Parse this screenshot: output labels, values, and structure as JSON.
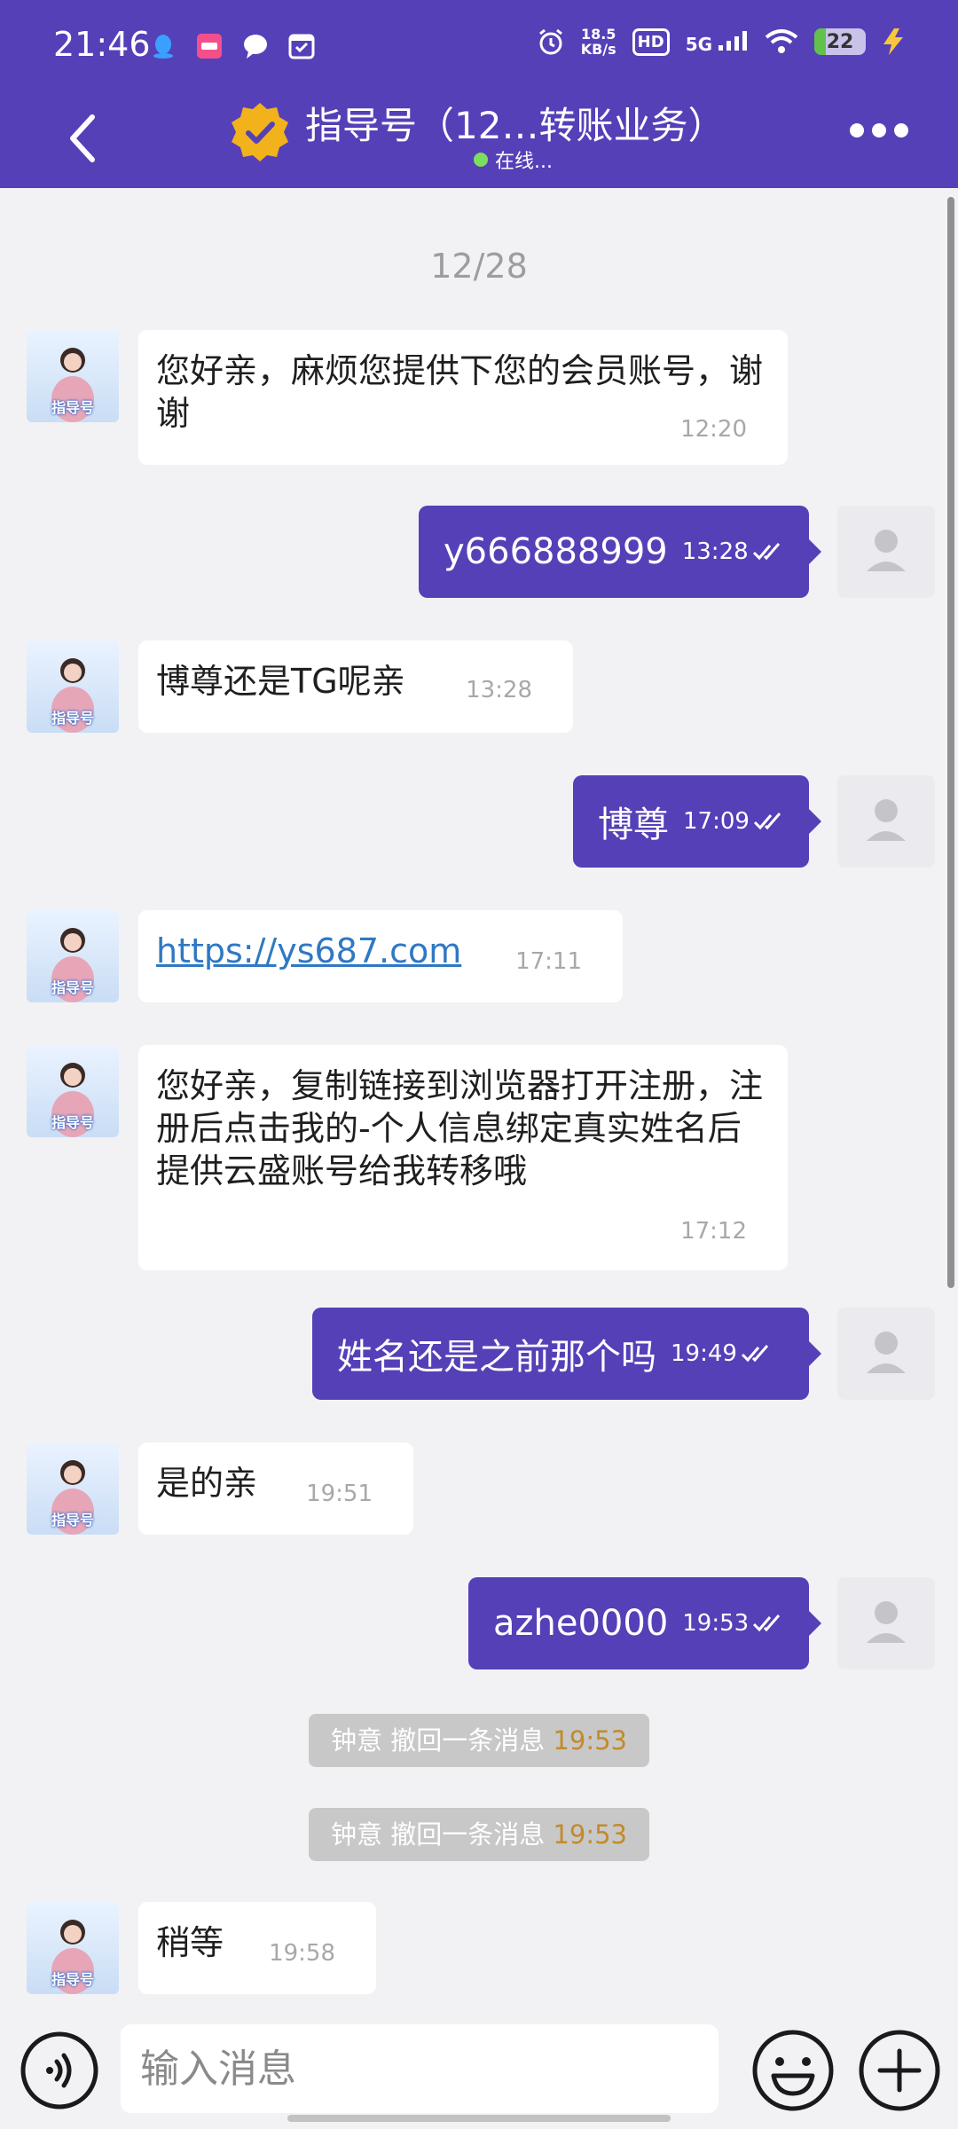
{
  "status_bar": {
    "time": "21:46",
    "net_speed_value": "18.5",
    "net_speed_unit": "KB/s",
    "hd": "HD",
    "network": "5G",
    "battery": "22"
  },
  "header": {
    "title": "指导号（12…转账业务）",
    "status": "在线..."
  },
  "chat": {
    "date": "12/28",
    "messages": [
      {
        "from": "bot",
        "text": "您好亲，麻烦您提供下您的会员账号，谢谢",
        "time": "12:20"
      },
      {
        "from": "me",
        "text": "y666888999",
        "time": "13:28"
      },
      {
        "from": "bot",
        "text": "博尊还是TG呢亲",
        "time": "13:28"
      },
      {
        "from": "me",
        "text": "博尊",
        "time": "17:09"
      },
      {
        "from": "bot",
        "text": "https://ys687.com",
        "time": "17:11"
      },
      {
        "from": "bot",
        "text": "您好亲，复制链接到浏览器打开注册，注册后点击我的-个人信息绑定真实姓名后提供云盛账号给我转移哦",
        "time": "17:12"
      },
      {
        "from": "me",
        "text": "姓名还是之前那个吗",
        "time": "19:49"
      },
      {
        "from": "bot",
        "text": "是的亲",
        "time": "19:51"
      },
      {
        "from": "me",
        "text": "azhe0000",
        "time": "19:53"
      },
      {
        "from": "bot",
        "text": "稍等",
        "time": "19:58"
      }
    ],
    "system_notices": [
      {
        "text": "钟意 撤回一条消息",
        "time": "19:53"
      },
      {
        "text": "钟意 撤回一条消息",
        "time": "19:53"
      }
    ],
    "bot_avatar_label": "指导号"
  },
  "input": {
    "placeholder": "输入消息"
  },
  "colors": {
    "brand": "#5540b8",
    "online": "#7dde5d",
    "link": "#2f78c4",
    "recall_time": "#c28b2a"
  }
}
